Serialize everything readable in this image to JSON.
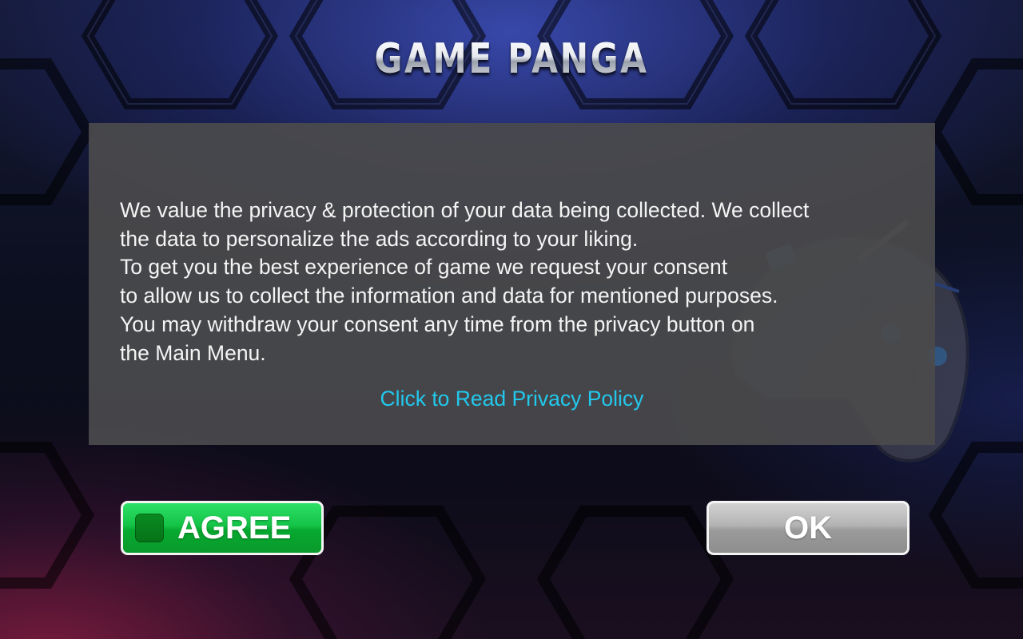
{
  "app": {
    "title": "GAME PANGA"
  },
  "consent_dialog": {
    "message_lines": [
      "We value the privacy & protection of your data being collected. We collect",
      "the data to personalize the ads according to your liking.",
      "To get you the best experience of game we request your consent",
      "to allow us to collect the information and data for mentioned purposes.",
      "You may withdraw your consent any time from the privacy button on",
      "the Main Menu."
    ],
    "privacy_link_label": "Click to Read Privacy Policy"
  },
  "buttons": {
    "agree_label": "AGREE",
    "ok_label": "OK"
  },
  "colors": {
    "link": "#22c8ec",
    "agree_green": "#13c447",
    "ok_gray": "#a5a5a5",
    "panel": "#4a4a4c"
  },
  "icons": {
    "agree_checkbox": "checkbox-icon",
    "background_art": "gamepad-icon"
  }
}
